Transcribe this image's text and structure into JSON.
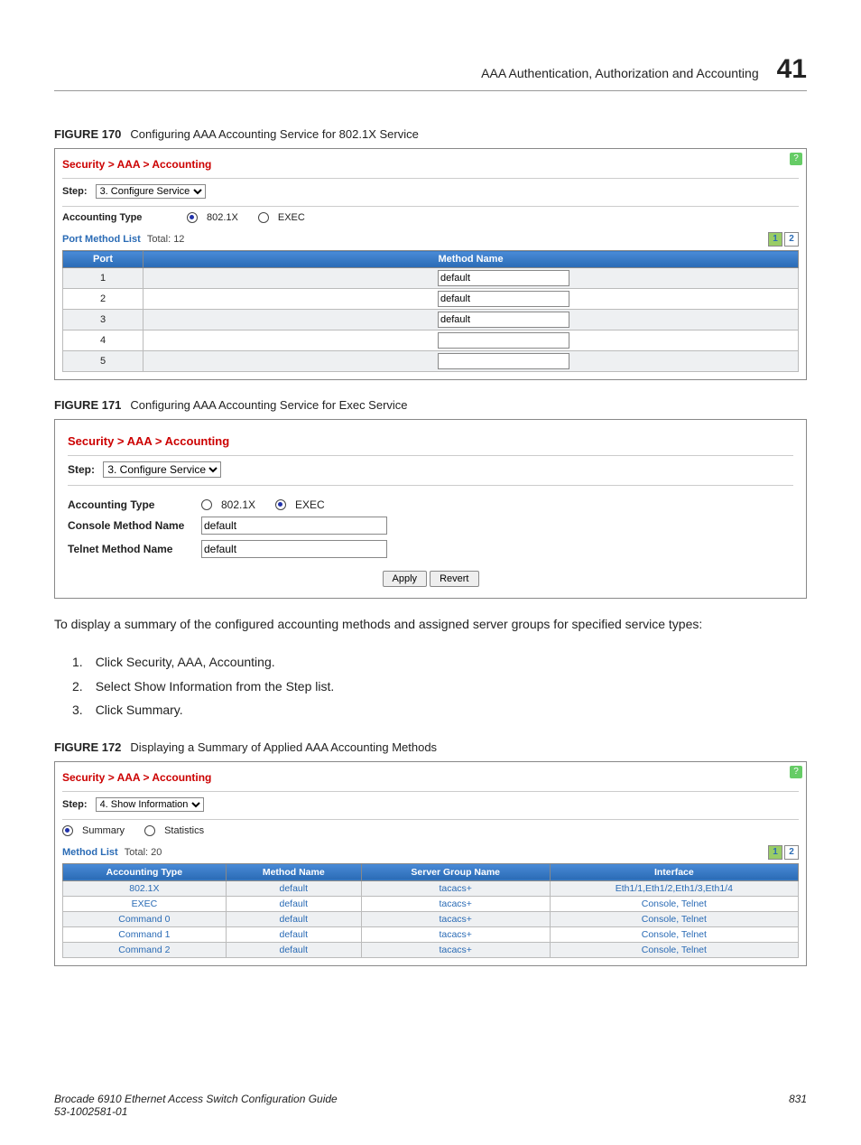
{
  "header": {
    "title": "AAA Authentication, Authorization and Accounting",
    "chapter": "41"
  },
  "fig170": {
    "label": "FIGURE 170",
    "caption": "Configuring AAA Accounting Service for 802.1X Service",
    "breadcrumb": "Security > AAA > Accounting",
    "step_label": "Step:",
    "step_value": "3. Configure Service",
    "acct_type_label": "Accounting Type",
    "radio1": "802.1X",
    "radio2": "EXEC",
    "list_label": "Port Method List",
    "list_total": "Total: 12",
    "pager": [
      "1",
      "2"
    ],
    "col_port": "Port",
    "col_method": "Method Name",
    "rows": [
      {
        "port": "1",
        "method": "default"
      },
      {
        "port": "2",
        "method": "default"
      },
      {
        "port": "3",
        "method": "default"
      },
      {
        "port": "4",
        "method": ""
      },
      {
        "port": "5",
        "method": ""
      }
    ]
  },
  "fig171": {
    "label": "FIGURE 171",
    "caption": "Configuring AAA Accounting Service for Exec Service",
    "breadcrumb": "Security > AAA > Accounting",
    "step_label": "Step:",
    "step_value": "3. Configure Service",
    "acct_type_label": "Accounting Type",
    "radio1": "802.1X",
    "radio2": "EXEC",
    "console_label": "Console Method Name",
    "console_value": "default",
    "telnet_label": "Telnet Method Name",
    "telnet_value": "default",
    "apply": "Apply",
    "revert": "Revert"
  },
  "summary_intro": "To display a summary of the configured accounting methods and assigned server groups for specified service types:",
  "steps": [
    "Click Security, AAA, Accounting.",
    "Select Show Information from the Step list.",
    "Click Summary."
  ],
  "fig172": {
    "label": "FIGURE 172",
    "caption": "Displaying a Summary of Applied AAA Accounting Methods",
    "breadcrumb": "Security > AAA > Accounting",
    "step_label": "Step:",
    "step_value": "4. Show Information",
    "radio1": "Summary",
    "radio2": "Statistics",
    "list_label": "Method List",
    "list_total": "Total: 20",
    "pager": [
      "1",
      "2"
    ],
    "cols": [
      "Accounting Type",
      "Method Name",
      "Server Group Name",
      "Interface"
    ],
    "rows": [
      {
        "t": "802.1X",
        "m": "default",
        "s": "tacacs+",
        "i": "Eth1/1,Eth1/2,Eth1/3,Eth1/4"
      },
      {
        "t": "EXEC",
        "m": "default",
        "s": "tacacs+",
        "i": "Console, Telnet"
      },
      {
        "t": "Command 0",
        "m": "default",
        "s": "tacacs+",
        "i": "Console, Telnet"
      },
      {
        "t": "Command 1",
        "m": "default",
        "s": "tacacs+",
        "i": "Console, Telnet"
      },
      {
        "t": "Command 2",
        "m": "default",
        "s": "tacacs+",
        "i": "Console, Telnet"
      }
    ]
  },
  "footer": {
    "line1": "Brocade 6910 Ethernet Access Switch Configuration Guide",
    "line2": "53-1002581-01",
    "page": "831"
  }
}
